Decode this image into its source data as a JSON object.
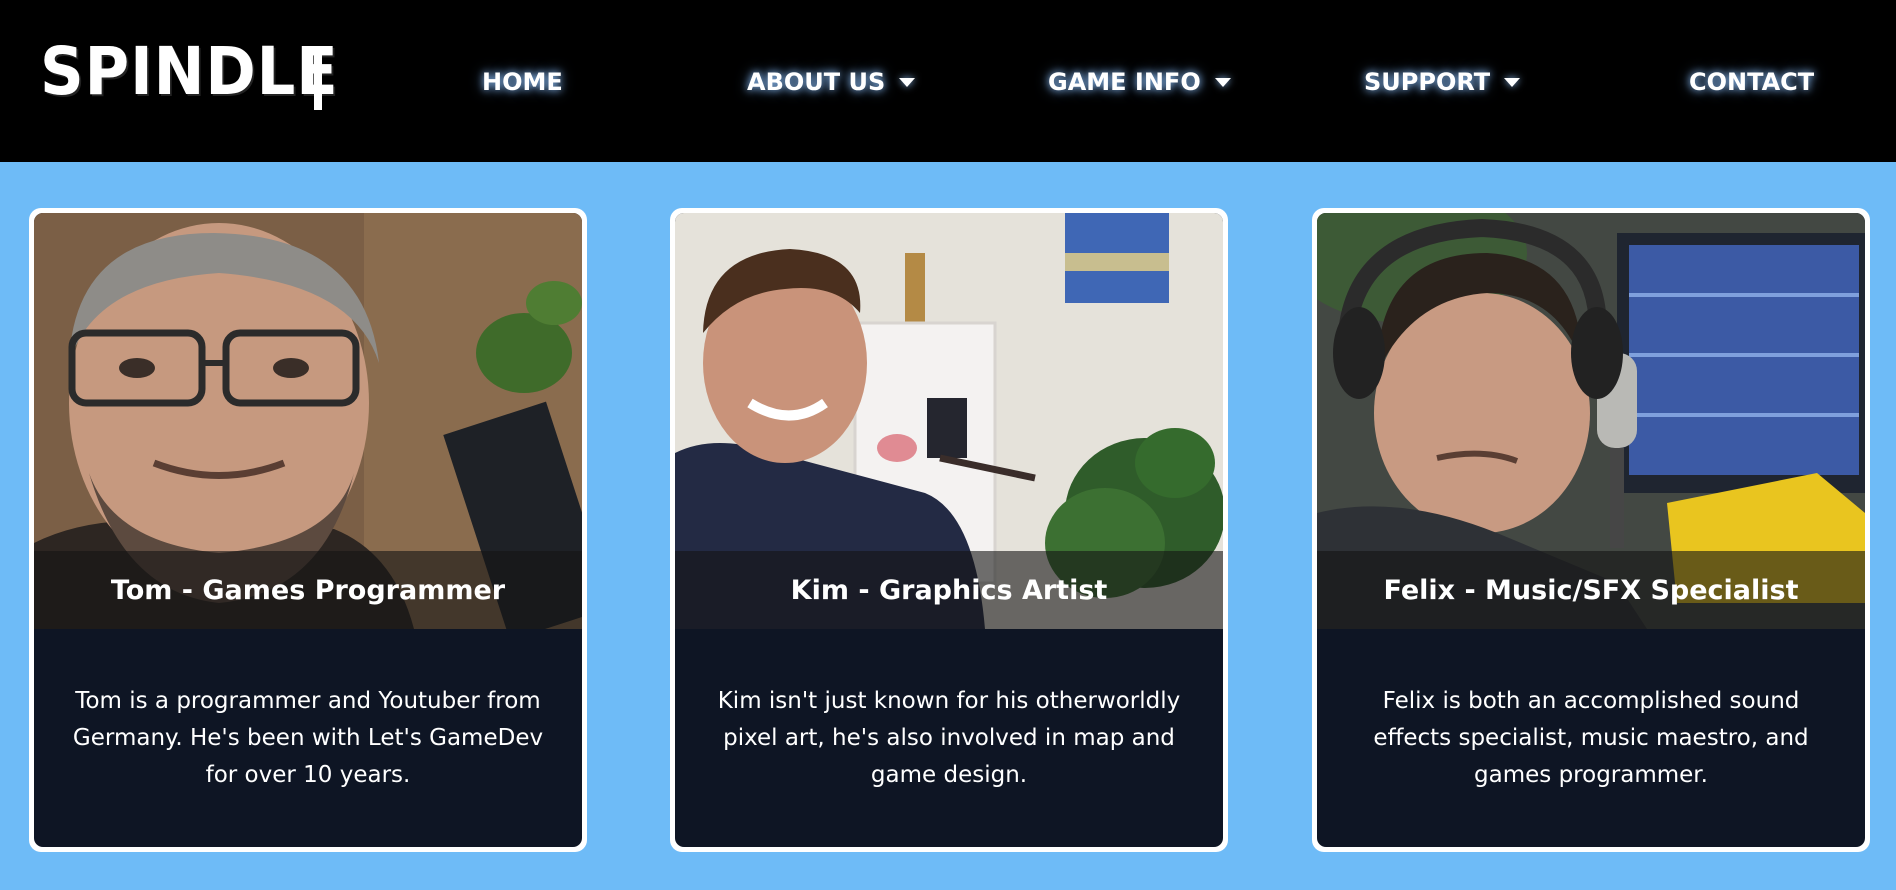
{
  "header": {
    "logo_text": "SPINDLE",
    "nav": [
      {
        "label": "HOME",
        "has_dropdown": false
      },
      {
        "label": "ABOUT US",
        "has_dropdown": true
      },
      {
        "label": "GAME INFO",
        "has_dropdown": true
      },
      {
        "label": "SUPPORT",
        "has_dropdown": true
      },
      {
        "label": "CONTACT",
        "has_dropdown": false
      }
    ]
  },
  "team": [
    {
      "name": "Tom - Games Programmer",
      "description": "Tom is a programmer and Youtuber from Germany. He's been with Let's GameDev for over 10 years."
    },
    {
      "name": "Kim - Graphics Artist",
      "description": "Kim isn't just known for his otherworldly pixel art, he's also involved in map and game design."
    },
    {
      "name": "Felix - Music/SFX Specialist",
      "description": "Felix is both an accomplished sound effects specialist, music maestro, and games programmer."
    }
  ],
  "colors": {
    "page_background": "#6ebbf7",
    "nav_background": "#000000",
    "card_background": "#0e1524",
    "card_border": "#ffffff"
  }
}
